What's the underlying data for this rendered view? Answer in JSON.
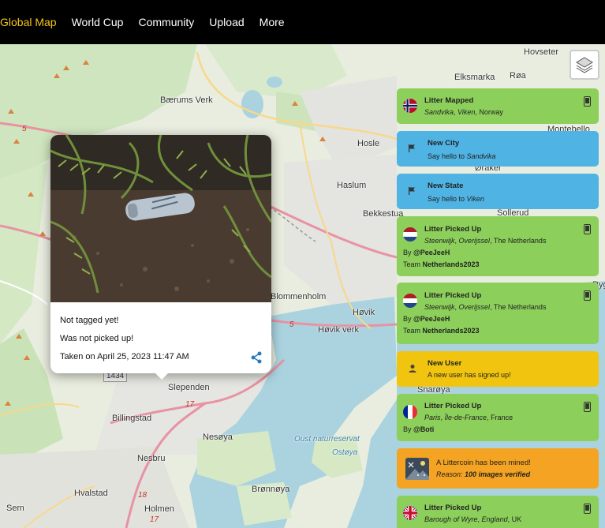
{
  "nav": {
    "items": [
      {
        "label": "Global Map"
      },
      {
        "label": "World Cup"
      },
      {
        "label": "Community"
      },
      {
        "label": "Upload"
      },
      {
        "label": "More"
      }
    ]
  },
  "map": {
    "labels": {
      "hovseter": "Hovseter",
      "elksmarka": "Elksmarka",
      "roa": "Røa",
      "baerums_verk": "Bærums Verk",
      "montebello": "Montebello",
      "hosle": "Hosle",
      "haslum": "Haslum",
      "oraker": "Øraker",
      "bekkestua": "Bekkestua",
      "sollerud": "Sollerud",
      "blommenholm": "Blommenholm",
      "hovik": "Høvik",
      "hovik_verk": "Høvik verk",
      "slependen": "Slependen",
      "snaroya": "Snarøya",
      "billingstad": "Billingstad",
      "nesoya": "Nesøya",
      "oust": "Oust naturreservat",
      "ostoya": "Ostøya",
      "nesbru": "Nesbru",
      "hvalstad": "Hvalstad",
      "holmen": "Holmen",
      "bronnoya": "Brønnøya",
      "sem": "Sem",
      "ryg": "Ryg"
    },
    "road_numbers": [
      "5",
      "5",
      "17",
      "18",
      "17"
    ],
    "shield": "1434",
    "layers_icon": "layers-icon"
  },
  "popup": {
    "photo_icon": "litter-photo",
    "tag_status": "Not tagged yet!",
    "pickup_status": "Was not picked up!",
    "taken": "Taken on April 25, 2023 11:47 AM",
    "share_icon": "share-icon"
  },
  "feed": [
    {
      "type": "green",
      "title": "Litter Mapped",
      "location_html": [
        "Sandvika",
        ", ",
        "Viken",
        ", Norway"
      ],
      "location": "Sandvika, Viken, Norway",
      "flag": "norway",
      "device": "mobile"
    },
    {
      "type": "blue",
      "title": "New City",
      "prefix": "Say hello to ",
      "emph": "Sandvika",
      "icon": "flag-icon"
    },
    {
      "type": "blue",
      "title": "New State",
      "prefix": "Say hello to ",
      "emph": "Viken",
      "icon": "flag-icon"
    },
    {
      "type": "green",
      "title": "Litter Picked Up",
      "loc_a": "Steenwijk",
      "loc_b": "Overijssel",
      "loc_c": ", The Netherlands",
      "by_label": "By ",
      "by": "@PeeJeeH",
      "team_label": "Team ",
      "team": "Netherlands2023",
      "flag": "netherlands",
      "device": "mobile"
    },
    {
      "type": "green",
      "title": "Litter Picked Up",
      "loc_a": "Steenwijk",
      "loc_b": "Overijssel",
      "loc_c": ", The Netherlands",
      "by_label": "By ",
      "by": "@PeeJeeH",
      "team_label": "Team ",
      "team": "Netherlands2023",
      "flag": "netherlands",
      "device": "mobile"
    },
    {
      "type": "yellow",
      "title": "New User",
      "sub": "A new user has signed up!",
      "icon": "user-icon"
    },
    {
      "type": "green",
      "title": "Litter Picked Up",
      "loc_a": "Paris",
      "loc_b": "Île-de-France",
      "loc_c": ", France",
      "by_label": "By ",
      "by": "@Boti",
      "flag": "france",
      "device": "mobile"
    },
    {
      "type": "orange",
      "title": "A Littercoin has been mined!",
      "reason_label": "Reason:",
      "reason": "100 images verified",
      "icon": "littercoin-icon"
    },
    {
      "type": "green",
      "title": "Litter Picked Up",
      "loc_a": "Barough of Wyre",
      "loc_b": "England",
      "loc_c": ", UK",
      "flag": "uk",
      "device": "mobile"
    }
  ],
  "colors": {
    "nav_bg": "#000000",
    "nav_active": "#f5c518",
    "card_green": "#8ccf5a",
    "card_blue": "#4fb3e3",
    "card_yellow": "#f1c40f",
    "card_orange": "#f4a322",
    "water": "#aad3df"
  }
}
